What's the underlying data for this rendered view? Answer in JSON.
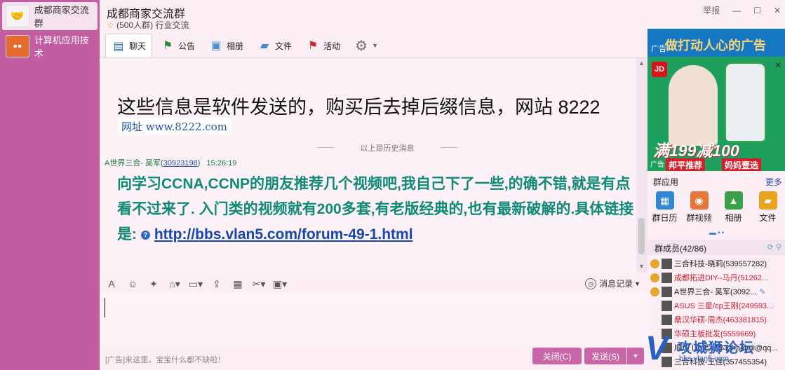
{
  "sidebar": {
    "groups": [
      {
        "label": "成都商家交流群",
        "icon": "handshake-icon"
      },
      {
        "label": "计算机应用技术",
        "icon": "group-icon"
      }
    ]
  },
  "header": {
    "title": "成都商家交流群",
    "member_count": "(500人群)",
    "category": "行业交流",
    "report": "举报"
  },
  "tabs": [
    {
      "label": "聊天",
      "icon": "chat-icon"
    },
    {
      "label": "公告",
      "icon": "announcement-icon"
    },
    {
      "label": "相册",
      "icon": "album-icon"
    },
    {
      "label": "文件",
      "icon": "folder-icon"
    },
    {
      "label": "活动",
      "icon": "flag-icon"
    }
  ],
  "chat": {
    "banner_text": "这些信息是软件发送的，购买后去掉后缀信息，网站 8222",
    "banner_url": "网址 www.8222.com",
    "history_divider": "以上是历史消息",
    "message": {
      "sender_name": "A世界三合- 吴军(",
      "sender_id": "30923198",
      "sender_close": ")",
      "time": "15:26:19",
      "text": "向学习CCNA,CCNP的朋友推荐几个视频吧,我自己下了一些,的确不错,就是有点看不过来了. 入门类的视频就有200多套,有老版经典的,也有最新破解的.具体链接是:",
      "link": "http://bbs.vlan5.com/forum-49-1.html"
    }
  },
  "toolbar": {
    "history_label": "消息记录"
  },
  "footer": {
    "ad_text": "[广告]来这里，宝宝什么都不缺啦！",
    "close_label": "关闭(C)",
    "send_label": "发送(S)"
  },
  "ad": {
    "tag": "广告",
    "slogan": "做打动人心的广告",
    "brand": "JD",
    "promo": "满199减100",
    "promo_sub": "妈妈壹选",
    "promo_sub2": "邦平推荐",
    "tag_bottom": "广告"
  },
  "apps": {
    "title": "群应用",
    "more": "更多",
    "items": [
      {
        "label": "群日历",
        "color": "#2f86d8"
      },
      {
        "label": "群视频",
        "color": "#e8743a"
      },
      {
        "label": "相册",
        "color": "#3aa04a"
      },
      {
        "label": "文件",
        "color": "#e9a31f"
      }
    ]
  },
  "members": {
    "title": "群成员(42/86)",
    "list": [
      {
        "name": "三合科技-晓莉(539557282)",
        "red": false
      },
      {
        "name": "成都拓进DIY--马丹(51262...",
        "red": true
      },
      {
        "name": "A世界三合- 吴军(3092...",
        "red": false
      },
      {
        "name": "ASUS 三星/cp王刚(249593...",
        "red": true
      },
      {
        "name": "鼎汉华硕-周杰(463381815)",
        "red": true
      },
      {
        "name": "华硕主板批发(5559669)",
        "red": true
      },
      {
        "name": "顺达 LG笔记本(zhaohui@qq...",
        "red": false
      },
      {
        "name": "三合科技-王佳(357455354)",
        "red": false
      }
    ]
  },
  "watermark": {
    "title": "攻城狮论坛",
    "url": "bbs.vlan5.com"
  }
}
